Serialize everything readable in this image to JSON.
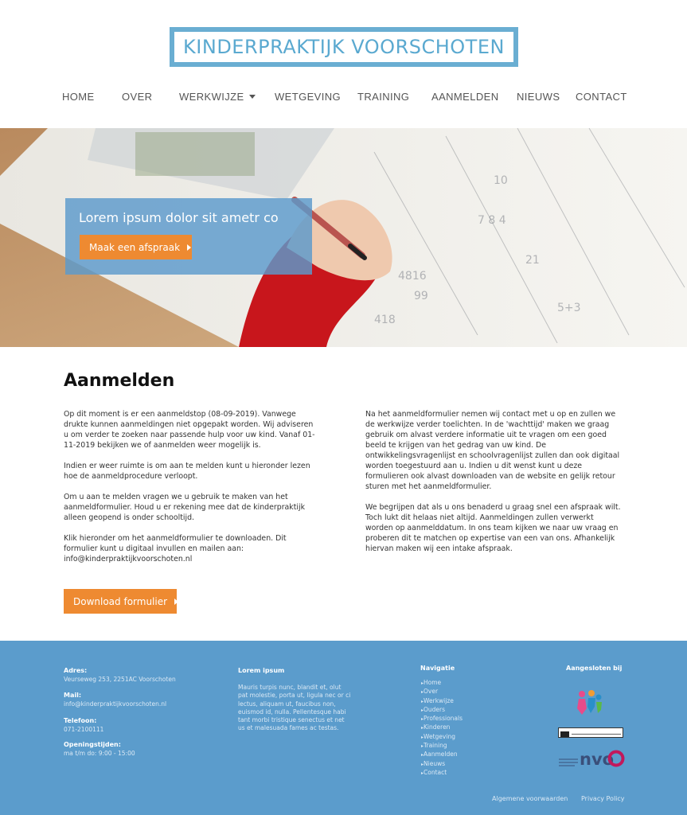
{
  "brand": {
    "logo_text": "KINDERPRAKTIJK VOORSCHOTEN",
    "accent": "#6aaed2",
    "orange": "#ee8a31",
    "footer_bg": "#5b9ccc"
  },
  "nav": {
    "items": [
      "HOME",
      "OVER",
      "WERKWIJZE",
      "WETGEVING",
      "TRAINING",
      "AANMELDEN",
      "NIEUWS",
      "CONTACT"
    ],
    "dropdown_icon": "caret-down-icon"
  },
  "hero": {
    "title": "Lorem ipsum dolor sit ametr co",
    "button_label": "Maak een afspraak"
  },
  "main": {
    "title": "Aanmelden",
    "left": [
      "Op dit moment is er een aanmeldstop (08-09-2019). Vanwege drukte kunnen aanmeldingen niet opgepakt worden.  Wij adviseren u om verder te zoeken naar passende hulp voor uw kind. Vanaf 01-11-2019 bekijken we of aanmelden weer mogelijk is.",
      "Indien er weer ruimte is om aan te melden kunt u hieronder lezen hoe de aanmeldprocedure verloopt.",
      "Om u aan te melden vragen we u gebruik te maken van het aanmeldformulier. Houd u er rekening mee dat de kinderpraktijk alleen geopend is onder schooltijd.",
      "Klik hieronder om het aanmeldformulier te downloaden. Dit formulier kunt u digitaal invullen en mailen aan: info@kinderpraktijkvoorschoten.nl"
    ],
    "right": [
      "Na het aanmeldformulier nemen wij contact met u op en zullen we de werkwijze verder toelichten. In de 'wachttijd' maken we graag gebruik om alvast verdere informatie uit te vragen om een goed beeld te krijgen van het gedrag van uw kind. De ontwikkelingsvragenlijst en schoolvragenlijst zullen dan ook digitaal worden toegestuurd aan u. Indien u dit wenst kunt u deze formulieren ook alvast downloaden van de website en gelijk retour sturen met het aanmeldformulier.",
      "We begrijpen dat als u ons benaderd u graag snel een afspraak wilt. Toch lukt dit helaas niet altijd. Aanmeldingen zullen verwerkt worden op aanmelddatum. In ons team kijken we naar uw vraag en proberen dit te matchen op expertise van een van ons. Afhankelijk hiervan maken wij een intake afspraak."
    ],
    "download_label": "Download formulier"
  },
  "footer": {
    "address_label": "Adres:",
    "address": "Veurseweg 253, 2251AC Voorschoten",
    "mail_label": "Mail:",
    "mail": "info@kinderpraktijkvoorschoten.nl",
    "phone_label": "Telefoon:",
    "phone": "071-2100111",
    "hours_label": "Openingstijden:",
    "hours": "ma t/m do: 9:00 - 15:00",
    "lorem_title": "Lorem ipsum",
    "lorem_text": "Mauris turpis nunc, blandit et, olut pat molestie, porta ut, ligula nec or ci lectus, aliquam ut, faucibus non, euismod id, nulla. Pellentesque habi tant morbi tristique senectus et net us et malesuada fames ac testas.",
    "nav_title": "Navigatie",
    "nav_items": [
      "Home",
      "Over",
      "Werkwijze",
      "Ouders",
      "Professionals",
      "Kinderen",
      "Wetgeving",
      "Training",
      "Aanmelden",
      "Nieuws",
      "Contact"
    ],
    "affiliated_title": "Aangesloten bij",
    "nvo_text": "nvo",
    "terms": "Algemene voorwaarden",
    "privacy": "Privacy Policy"
  }
}
